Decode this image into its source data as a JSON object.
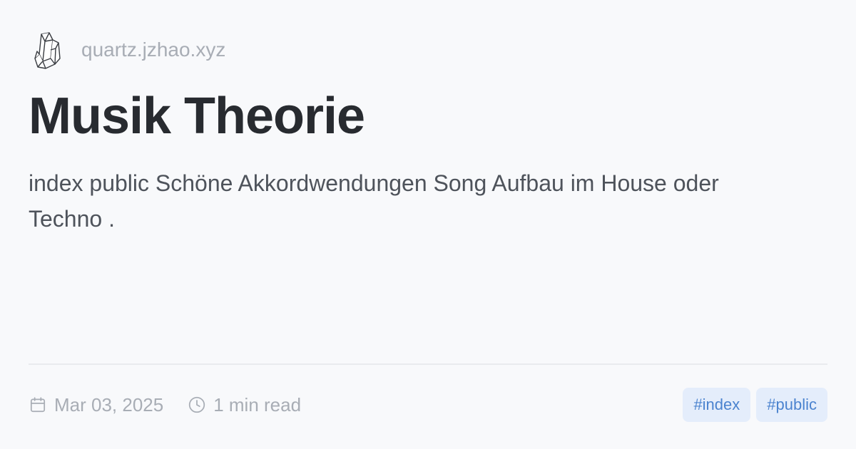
{
  "header": {
    "logo_icon": "crystal-logo-icon",
    "site_name": "quartz.jzhao.xyz"
  },
  "page": {
    "title": "Musik Theorie",
    "description": "index public Schöne Akkordwendungen Song Aufbau im House oder Techno ."
  },
  "meta": {
    "date_icon": "calendar-icon",
    "date": "Mar 03, 2025",
    "reading_time_icon": "clock-icon",
    "reading_time": "1 min read"
  },
  "tags": [
    {
      "label": "#index"
    },
    {
      "label": "#public"
    }
  ],
  "colors": {
    "background": "#f8f9fb",
    "title": "#282b30",
    "body_text": "#4e535b",
    "muted": "#a8adb5",
    "tag_bg": "#e4edfb",
    "tag_text": "#4b83cf"
  }
}
